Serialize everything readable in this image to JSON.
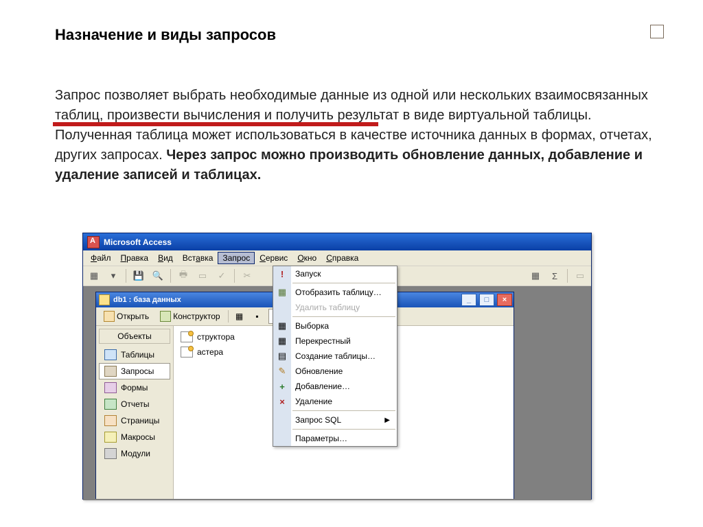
{
  "slide": {
    "heading": "Назначение и виды запросов",
    "body_part1": "Запрос позволяет выбрать необходимые данные из одной или нескольких взаимосвязанных таблиц, произвести вычисления и получить результат в виде виртуальной таблицы. Полученная таблица может использоваться в качестве источника данных в формах, отчетах, других запросах. ",
    "body_bold": "Через запрос можно производить обновление данных, добавление и удаление записей и таблицах."
  },
  "app": {
    "title": "Microsoft Access",
    "menubar": {
      "file": "Файл",
      "edit": "Правка",
      "view": "Вид",
      "insert": "Вставка",
      "query": "Запрос",
      "service": "Сервис",
      "window": "Окно",
      "help": "Справка"
    },
    "toolbar_right": {
      "sigma": "Σ"
    },
    "db_window": {
      "title": "db1 : база данных",
      "open": "Открыть",
      "design": "Конструктор",
      "objects_header": "Объекты",
      "items": {
        "tables": "Таблицы",
        "queries": "Запросы",
        "forms": "Формы",
        "reports": "Отчеты",
        "pages": "Страницы",
        "macros": "Макросы",
        "modules": "Модули"
      },
      "content": {
        "designer_suffix": "структора",
        "wizard_suffix": "астера"
      }
    },
    "dropdown": {
      "run": "Запуск",
      "show_table": "Отобразить таблицу…",
      "delete_table": "Удалить таблицу",
      "select": "Выборка",
      "crosstab": "Перекрестный",
      "make_table": "Создание таблицы…",
      "update": "Обновление",
      "append": "Добавление…",
      "delete": "Удаление",
      "sql": "Запрос SQL",
      "params": "Параметры…"
    }
  }
}
